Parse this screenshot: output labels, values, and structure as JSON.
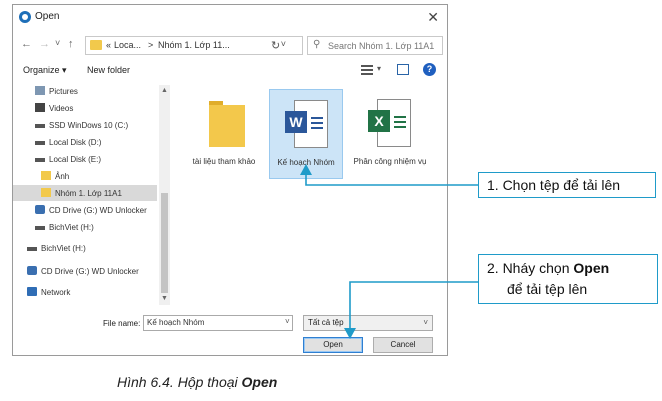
{
  "dialog": {
    "title": "Open",
    "close": "✕",
    "nav": {
      "back": "←",
      "forward": "→",
      "recent": "˅",
      "up": "↑"
    },
    "address": {
      "prefix": "«",
      "seg1": "Loca...",
      "sep": ">",
      "seg2": "Nhóm 1. Lớp 11...",
      "chevron": "˅",
      "refresh": "↻"
    },
    "search_placeholder": "Search Nhóm 1. Lớp 11A1",
    "toolbar": {
      "organize": "Organize ▾",
      "new_folder": "New folder",
      "view_chevron": "▾",
      "help": "?"
    },
    "sidebar": {
      "items": [
        {
          "label": "Pictures",
          "icon": "pictures-icon"
        },
        {
          "label": "Videos",
          "icon": "videos-icon"
        },
        {
          "label": "SSD   WinDows 10 (C:)",
          "icon": "drive-icon"
        },
        {
          "label": "Local Disk (D:)",
          "icon": "drive-icon"
        },
        {
          "label": "Local Disk (E:)",
          "icon": "drive-icon"
        },
        {
          "label": "Ảnh",
          "icon": "folder-icon"
        },
        {
          "label": "Nhóm 1. Lớp 11A1",
          "icon": "folder-icon",
          "selected": true
        },
        {
          "label": "CD Drive (G:) WD Unlocker",
          "icon": "cd-drive-icon"
        },
        {
          "label": "BichViet (H:)",
          "icon": "drive-icon"
        },
        {
          "label": "BichViet (H:)",
          "icon": "drive-icon"
        },
        {
          "label": "CD Drive (G:) WD Unlocker",
          "icon": "cd-drive-icon"
        },
        {
          "label": "Network",
          "icon": "network-icon"
        }
      ],
      "scroll_up": "▲",
      "scroll_down": "▼"
    },
    "files": [
      {
        "name": "tài liệu tham khảo",
        "kind": "folder"
      },
      {
        "name": "Kế hoạch Nhóm",
        "kind": "word",
        "badge": "W",
        "selected": true
      },
      {
        "name": "Phân công nhiệm vụ",
        "kind": "excel",
        "badge": "X"
      }
    ],
    "file_name_label": "File name:",
    "file_name_value": "Kế hoạch Nhóm",
    "file_name_chevron": "˅",
    "file_type": "Tất cả tệp",
    "file_type_chevron": "˅",
    "open_button": "Open",
    "cancel_button": "Cancel"
  },
  "colors": {
    "word": "#2b579a",
    "excel": "#217346",
    "callout_line": "#1f9bc9",
    "selected": "#cce4f7"
  },
  "callouts": {
    "step1": "1. Chọn tệp để tải lên",
    "step2_prefix": "2. Nháy chọn ",
    "step2_bold": "Open",
    "step2_line2": "để tải tệp lên"
  },
  "caption": {
    "prefix": "Hình 6.4. Hộp thoại ",
    "bold": "Open"
  }
}
